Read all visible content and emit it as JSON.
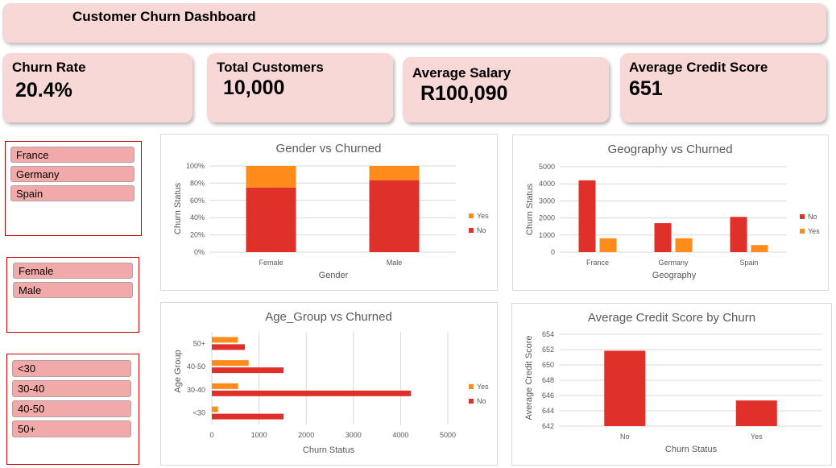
{
  "header": {
    "title": "Customer Churn Dashboard"
  },
  "kpis": {
    "churn_rate": {
      "label": "Churn Rate",
      "value": "20.4%"
    },
    "total_customers": {
      "label": "Total Customers",
      "value": "10,000"
    },
    "average_salary": {
      "label": "Average Salary",
      "value": "R100,090"
    },
    "average_credit_score": {
      "label": "Average Credit Score",
      "value": "651"
    }
  },
  "slicers": {
    "geography": [
      "France",
      "Germany",
      "Spain"
    ],
    "gender": [
      "Female",
      "Male"
    ],
    "age_group": [
      "<30",
      "30-40",
      "40-50",
      "50+"
    ]
  },
  "colors": {
    "no": "#e0302a",
    "yes": "#ff8c1a",
    "card": "#f8d7d7",
    "slicer_item": "#f2a9a9",
    "slicer_border": "#c00000"
  },
  "chart_data": [
    {
      "type": "bar",
      "stacked": "percent",
      "title": "Gender vs Churned",
      "xlabel": "Gender",
      "ylabel": "Churn Status",
      "categories": [
        "Female",
        "Male"
      ],
      "yticks": [
        "0%",
        "20%",
        "40%",
        "60%",
        "80%",
        "100%"
      ],
      "ylim": [
        0,
        100
      ],
      "series": [
        {
          "name": "No",
          "color": "#e0302a",
          "values": [
            75,
            83.5
          ]
        },
        {
          "name": "Yes",
          "color": "#ff8c1a",
          "values": [
            25,
            16.5
          ]
        }
      ],
      "legend": "right"
    },
    {
      "type": "bar",
      "title": "Geography vs Churned",
      "xlabel": "Geography",
      "ylabel": "Churn Status",
      "categories": [
        "France",
        "Germany",
        "Spain"
      ],
      "yticks": [
        "0",
        "1000",
        "2000",
        "3000",
        "4000",
        "5000"
      ],
      "ylim": [
        0,
        5000
      ],
      "series": [
        {
          "name": "No",
          "color": "#e0302a",
          "values": [
            4204,
            1695,
            2064
          ]
        },
        {
          "name": "Yes",
          "color": "#ff8c1a",
          "values": [
            810,
            814,
            413
          ]
        }
      ],
      "legend": "right"
    },
    {
      "type": "bar",
      "orientation": "horizontal",
      "title": "Age_Group vs Churned",
      "xlabel": "Churn Status",
      "ylabel": "Age Group",
      "categories": [
        "<30",
        "30-40",
        "40-50",
        "50+"
      ],
      "xticks": [
        "0",
        "1000",
        "2000",
        "3000",
        "4000",
        "5000"
      ],
      "xlim": [
        0,
        5000
      ],
      "series": [
        {
          "name": "No",
          "color": "#e0302a",
          "values": [
            1520,
            4220,
            1520,
            700
          ]
        },
        {
          "name": "Yes",
          "color": "#ff8c1a",
          "values": [
            130,
            560,
            780,
            550
          ]
        }
      ],
      "legend": "right"
    },
    {
      "type": "bar",
      "title": "Average Credit Score by Churn",
      "xlabel": "Churn Status",
      "ylabel": "Average Credit Score",
      "categories": [
        "No",
        "Yes"
      ],
      "yticks": [
        "642",
        "644",
        "646",
        "648",
        "650",
        "652",
        "654"
      ],
      "ylim": [
        642,
        654
      ],
      "values": [
        651.85,
        645.35
      ],
      "color": "#e0302a"
    }
  ]
}
